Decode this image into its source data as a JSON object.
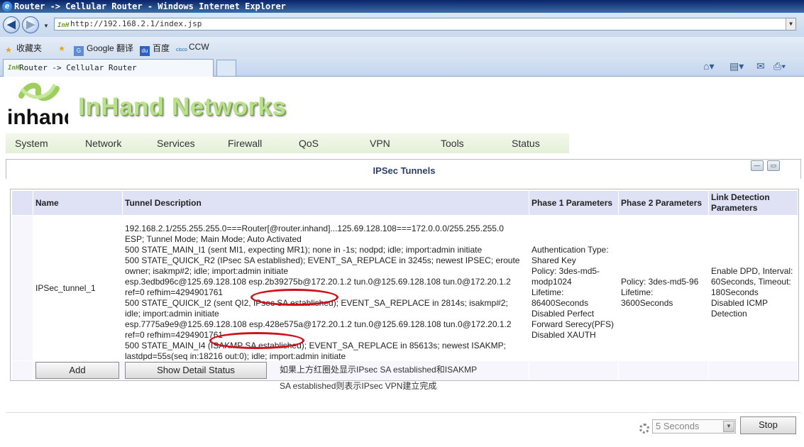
{
  "browser": {
    "title": "Router -> Cellular Router - Windows Internet Explorer",
    "url": "http://192.168.2.1/index.jsp",
    "favorites_label": "收藏夹",
    "favorites": [
      "Google 翻译",
      "百度",
      "CCW"
    ],
    "tab_title": "Router -> Cellular Router"
  },
  "brand": {
    "logo_text": "inhand",
    "name": "InHand Networks"
  },
  "menu": [
    "System",
    "Network",
    "Services",
    "Firewall",
    "QoS",
    "VPN",
    "Tools",
    "Status"
  ],
  "panel": {
    "title": "IPSec Tunnels"
  },
  "table": {
    "headers": {
      "name": "Name",
      "desc": "Tunnel Description",
      "p1": "Phase 1 Parameters",
      "p2": "Phase 2 Parameters",
      "link": "Link Detection Parameters"
    },
    "row": {
      "name": "IPSec_tunnel_1",
      "desc": [
        "192.168.2.1/255.255.255.0===Router[@router.inhand]...125.69.128.108===172.0.0.0/255.255.255.0",
        "ESP; Tunnel Mode; Main Mode; Auto Activated",
        "500 STATE_MAIN_I1 (sent MI1, expecting MR1); none in -1s; nodpd; idle; import:admin initiate",
        "500 STATE_QUICK_R2 (IPsec SA established); EVENT_SA_REPLACE in 3245s; newest IPSEC; eroute",
        "owner; isakmp#2; idle; import:admin initiate",
        "esp.3edbd96c@125.69.128.108 esp.2b39275b@172.20.1.2 tun.0@125.69.128.108 tun.0@172.20.1.2",
        "ref=0 refhim=4294901761",
        "500 STATE_QUICK_I2 (sent QI2, IPsec SA established); EVENT_SA_REPLACE in 2814s; isakmp#2;",
        "idle; import:admin initiate",
        "esp.7775a9e9@125.69.128.108 esp.428e575a@172.20.1.2 tun.0@125.69.128.108 tun.0@172.20.1.2",
        "ref=0 refhim=4294901761",
        "500 STATE_MAIN_I4 (ISAKMP SA established); EVENT_SA_REPLACE in 85613s; newest ISAKMP;",
        "lastdpd=55s(seq in:18216 out:0); idle; import:admin initiate"
      ],
      "p1": [
        "Authentication Type:",
        "Shared Key",
        "Policy: 3des-md5-",
        "modp1024",
        "Lifetime:",
        "86400Seconds",
        "Disabled Perfect",
        "Forward Serecy(PFS)",
        "Disabled XAUTH"
      ],
      "p2": [
        "Policy: 3des-md5-96",
        "Lifetime:",
        "3600Seconds"
      ],
      "link": [
        "Enable DPD, Interval:",
        "60Seconds, Timeout:",
        "180Seconds",
        "Disabled ICMP",
        "Detection"
      ]
    }
  },
  "actions": {
    "add_label": "Add",
    "detail_label": "Show Detail Status",
    "note_line1": "如果上方红圈处显示IPsec SA established和ISAKMP",
    "note_line2": "SA established则表示IPsec VPN建立完成"
  },
  "refresh": {
    "interval": "5 Seconds",
    "stop_label": "Stop"
  },
  "colors": {
    "brand_green": "#b9e08a",
    "header_bg": "#dfe1f5",
    "highlight_circle": "#d0101a"
  }
}
